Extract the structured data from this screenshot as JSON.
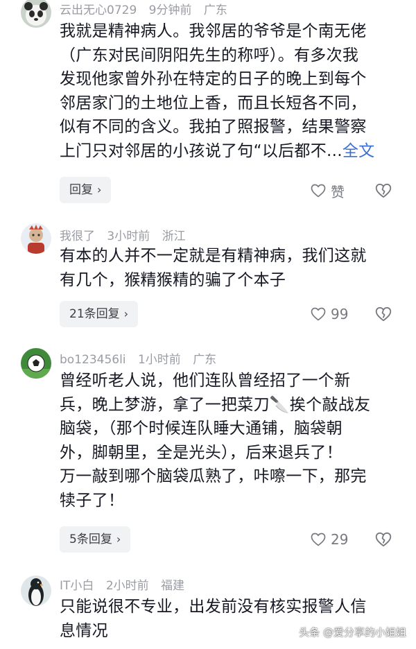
{
  "comments": [
    {
      "user": "云出无心0729",
      "time": "9分钟前",
      "location": "广东",
      "lines": [
        "我就是精神病人。我邻居的爷爷是个南无佬",
        "（广东对民间阴阳先生的称呼）。有多次我",
        "发现他家曾外孙在特定的日子的晚上到每个",
        "邻居家门的土地位上香，而且长短各不同，",
        "似有不同的含义。我拍了照报警，结果警察",
        "上门只对邻居的小孩说了句“以后都不..."
      ],
      "more": "全文",
      "reply_label": "回复",
      "likes": "赞"
    },
    {
      "user": "我很了",
      "time": "3小时前",
      "location": "浙江",
      "lines": [
        "有本的人并不一定就是有精神病，我们这就",
        "有几个，猴精猴精的骗了个本子"
      ],
      "reply_label": "21条回复",
      "likes": "99"
    },
    {
      "user": "bo123456li",
      "time": "1小时前",
      "location": "广东",
      "lines": [
        "曾经听老人说，他们连队曾经招了一个新",
        "兵，晚上梦游，拿了一把菜刀🔪挨个敲战友",
        "脑袋，（那个时候连队睡大通铺，脑袋朝",
        "外，脚朝里，全是光头），后来退兵了！",
        "万一敲到哪个脑袋瓜熟了，咔嚓一下，那完",
        "犊子了！"
      ],
      "reply_label": "5条回复",
      "likes": "29"
    },
    {
      "user": "IT小白",
      "time": "2小时前",
      "location": "福建",
      "lines": [
        "只能说很不专业，出发前没有核实报警人信",
        "息情况"
      ]
    }
  ],
  "watermark": "头条 @爱分享的小姐姐",
  "colors": {
    "link": "#3a6fd8",
    "meta": "#9a9ca3",
    "text": "#161823",
    "reply_bg": "#f1f2f4"
  },
  "icons": {
    "like": "heart-icon",
    "dislike": "broken-heart-icon",
    "reply_chevron": "chevron-right-icon"
  }
}
